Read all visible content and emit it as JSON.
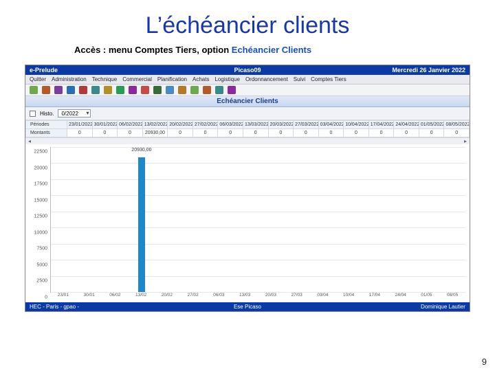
{
  "slide": {
    "title": "L’échéancier clients",
    "access_prefix": "Accès : menu ",
    "access_bold": "Comptes Tiers",
    "access_middle": ", option ",
    "access_link": "Echéancier Clients",
    "page_number": "9"
  },
  "app": {
    "title_left": "e-Prelude",
    "title_center": "Picaso09",
    "title_right": "Mercredi 26 Janvier 2022",
    "menu": [
      "Quitter",
      "Administration",
      "Technique",
      "Commercial",
      "Planification",
      "Achats",
      "Logistique",
      "Ordonnancement",
      "Suivi",
      "Comptes Tiers"
    ],
    "toolbar_colors": [
      "#6fa84f",
      "#b35a2a",
      "#7a3e9c",
      "#2a6eb3",
      "#b33a3a",
      "#3a8a8a",
      "#b38f2a",
      "#2a9c5a",
      "#8a2a9c",
      "#c74a4a",
      "#3a6a3a",
      "#4a8ac7",
      "#b37a2a",
      "#6fa84f",
      "#b35a2a",
      "#3a8a8a",
      "#8a2a9c"
    ],
    "panel_title": "Echéancier Clients",
    "controls": {
      "histo_label": "Histo.",
      "combo_value": "0/2022"
    },
    "grid": {
      "row_labels": [
        "Périodes",
        "Montants"
      ],
      "headers": [
        "23/01/2022",
        "30/01/2022",
        "06/02/2022",
        "13/02/2022",
        "20/02/2022",
        "27/02/2022",
        "06/03/2022",
        "13/03/2022",
        "20/03/2022",
        "27/03/2022",
        "03/04/2022",
        "10/04/2022",
        "17/04/2022",
        "24/04/2022",
        "01/05/2022",
        "08/05/2022"
      ],
      "values": [
        "0",
        "0",
        "0",
        "20930,00",
        "0",
        "0",
        "0",
        "0",
        "0",
        "0",
        "0",
        "0",
        "0",
        "0",
        "0",
        "0"
      ]
    },
    "status": {
      "left": "HEC - Paris - gpao -",
      "center": "Ese Picaso",
      "right": "Dominique Lautier"
    }
  },
  "chart_data": {
    "type": "bar",
    "title": "",
    "xlabel": "",
    "ylabel": "",
    "ylim": [
      0,
      22500
    ],
    "y_ticks": [
      0,
      2500,
      5000,
      7500,
      10000,
      12500,
      15000,
      17500,
      20000,
      22500
    ],
    "y_tick_labels": [
      "0",
      "2500",
      "5000",
      "7500",
      "10000",
      "12500",
      "15000",
      "17500",
      "20000",
      "22500"
    ],
    "categories": [
      "23/01",
      "30/01",
      "06/02",
      "13/02",
      "20/02",
      "27/02",
      "06/03",
      "13/03",
      "20/03",
      "27/03",
      "03/04",
      "10/04",
      "17/04",
      "24/04",
      "01/05",
      "08/05"
    ],
    "values": [
      0,
      0,
      0,
      20930,
      0,
      0,
      0,
      0,
      0,
      0,
      0,
      0,
      0,
      0,
      0,
      0
    ],
    "value_labels": [
      "",
      "",
      "",
      "20930,00",
      "",
      "",
      "",
      "",
      "",
      "",
      "",
      "",
      "",
      "",
      "",
      ""
    ]
  }
}
